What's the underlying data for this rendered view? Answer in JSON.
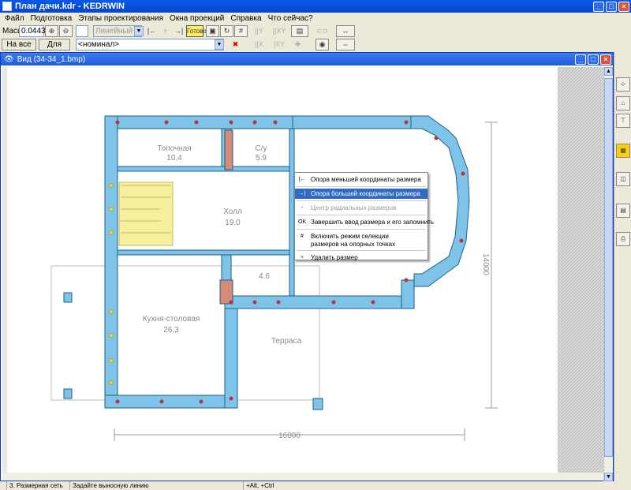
{
  "window": {
    "title": "План дачи.kdr - KEDRWIN",
    "buttons": [
      "_",
      "□",
      "×"
    ]
  },
  "menu": [
    "Файл",
    "Подготовка",
    "Этапы проектирования",
    "Окна проекций",
    "Справка",
    "Что сейчас?"
  ],
  "toolbar": {
    "scale_label": "Масшт",
    "scale_value": "0.0443",
    "fit_button": "На все окно",
    "all_button": "Для всех",
    "line_type": "Линейный",
    "dim_mode": "<номинал>",
    "ready_button": "Готово"
  },
  "document": {
    "title": "Вид (34-34_1.bmp)"
  },
  "plan": {
    "rooms": [
      {
        "name": "Топочная",
        "area": "10.4"
      },
      {
        "name": "С/у",
        "area": "5.9"
      },
      {
        "name": "Холл",
        "area": "19.0"
      },
      {
        "name": "",
        "area": "4.6"
      },
      {
        "name": "Кухня-столовая",
        "area": "26.3"
      },
      {
        "name": "Терраса",
        "area": ""
      }
    ],
    "dim_horizontal": "16000",
    "dim_vertical": "14000"
  },
  "context_menu": {
    "items": [
      {
        "label": "Опора меньшей координаты размера",
        "icon": "|←"
      },
      {
        "label": "Опора большей координаты размера",
        "icon": "→|"
      },
      {
        "label": "Центр радиальных размеров",
        "icon": "+"
      },
      {
        "label": "Завершить ввод размера и его запомнить",
        "icon": "OK"
      },
      {
        "label": "Включить режим селекции",
        "label2": "размеров на опорных точках",
        "icon": "#"
      },
      {
        "label": "Удалить размер",
        "icon": "×"
      }
    ]
  },
  "statusbar": {
    "stage": "3. Размерная сеть",
    "hint": "Задайте выносную линию",
    "keys": "+Alt, +Ctrl"
  },
  "colors": {
    "wall": "#7ec3e8",
    "wall_stroke": "#1f5f8a",
    "stair": "#f5f0a0",
    "accent": "#316ac5"
  }
}
